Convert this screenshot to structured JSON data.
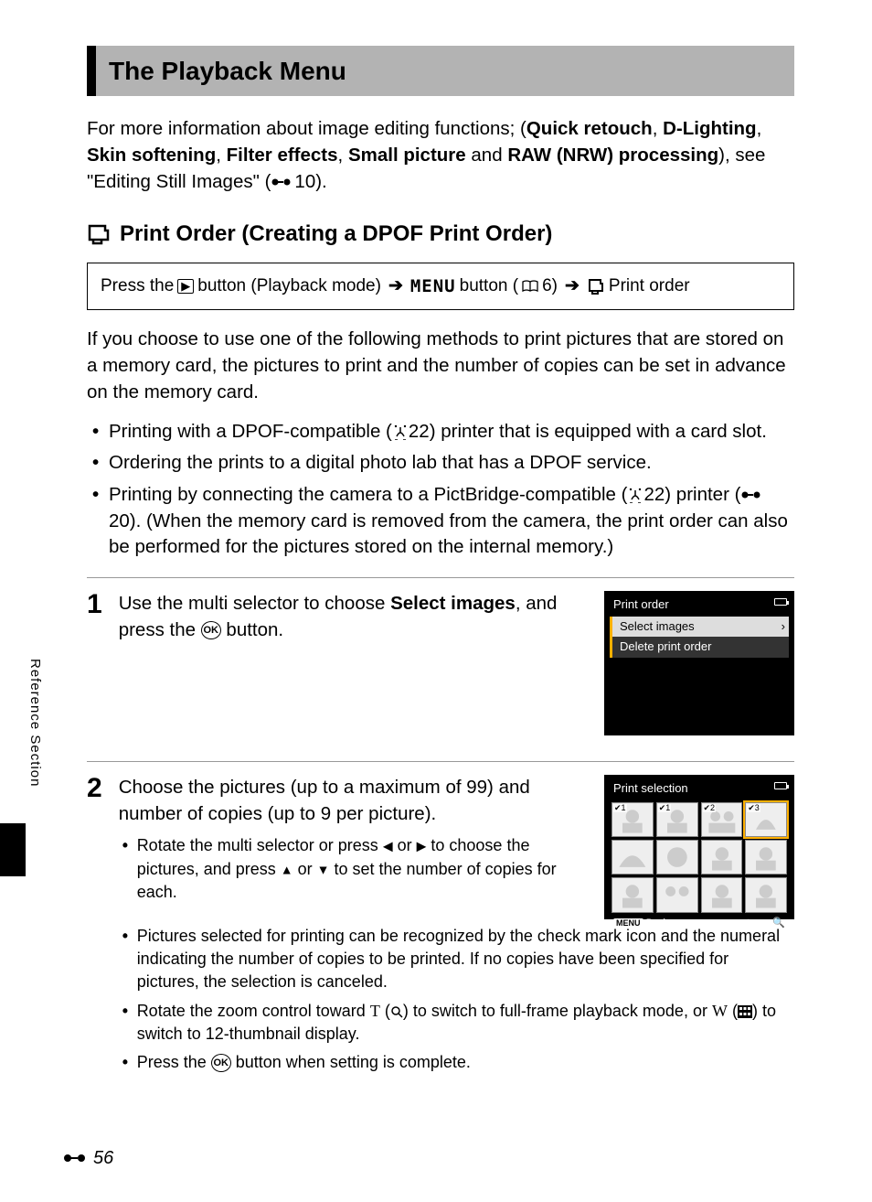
{
  "title": "The Playback Menu",
  "intro": {
    "lead": "For more information about image editing functions; (",
    "b1": "Quick retouch",
    "c1": ", ",
    "b2": "D-Lighting",
    "c2": ", ",
    "b3": "Skin softening",
    "c3": ", ",
    "b4": "Filter effects",
    "c4": ", ",
    "b5": "Small picture",
    "c5": " and ",
    "b6": "RAW (NRW) processing",
    "tail": "), see \"Editing Still Images\" (",
    "ref": "10).",
    "ref_icon_a": "E"
  },
  "subhead": "Print Order (Creating a DPOF Print Order)",
  "nav": {
    "press_the": "Press the",
    "playback_mode": "button (Playback mode)",
    "menu_label": "MENU",
    "button_label": "button (",
    "six": "6)",
    "print_order": "Print order"
  },
  "explain": "If you choose to use one of the following methods to print pictures that are stored on a memory card, the pictures to print and the number of copies can be set in advance on the memory card.",
  "bullets": {
    "b1a": "Printing with a DPOF-compatible (",
    "b1b": "22) printer that is equipped with a card slot.",
    "b2": "Ordering the prints to a digital photo lab that has a DPOF service.",
    "b3a": "Printing by connecting the camera to a PictBridge-compatible (",
    "b3b": "22) printer (",
    "b3c": "20). (When the memory card is removed from the camera, the print order can also be performed for the pictures stored on the internal memory.)"
  },
  "step1": {
    "num": "1",
    "text_a": "Use the multi selector to choose ",
    "text_b": "Select images",
    "text_c": ", and press the ",
    "text_d": " button.",
    "screen_title": "Print order",
    "opt1": "Select images",
    "opt2": "Delete print order"
  },
  "step2": {
    "num": "2",
    "head": "Choose the pictures (up to a maximum of 99) and number of copies (up to 9 per picture).",
    "sub1a": "Rotate the multi selector or press ",
    "sub1b": " or ",
    "sub1c": " to choose the pictures, and press ",
    "sub1d": " or ",
    "sub1e": " to set the number of copies for each.",
    "sub2": "Pictures selected for printing can be recognized by the check mark icon and the numeral indicating the number of copies to be printed. If no copies have been specified for pictures, the selection is canceled.",
    "sub3a": "Rotate the zoom control toward ",
    "sub3b": "T",
    "sub3c": " (",
    "sub3d": ") to switch to full-frame playback mode, or ",
    "sub3e": "W",
    "sub3f": " (",
    "sub3g": ") to switch to 12-thumbnail display.",
    "sub4a": "Press the ",
    "sub4b": " button when setting is complete.",
    "screen_title": "Print selection",
    "back": "Back",
    "marks": [
      "✔1",
      "✔1",
      "✔2",
      "✔3"
    ]
  },
  "side_label": "Reference Section",
  "page_number": "56"
}
